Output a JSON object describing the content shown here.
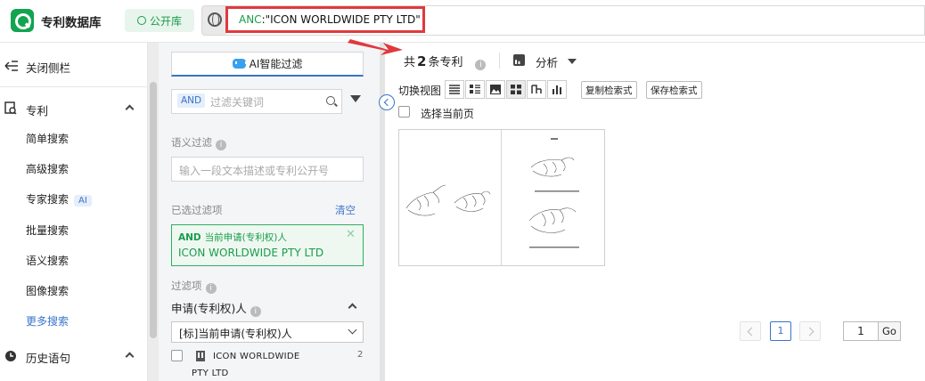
{
  "header": {
    "app_title": "专利数据库",
    "db_button": "公开库",
    "query_field": "ANC",
    "query_value": ":\"ICON WORLDWIDE PTY LTD\""
  },
  "sidebar": {
    "close_label": "关闭侧栏",
    "patent_section": "专利",
    "items": [
      {
        "label": "简单搜索"
      },
      {
        "label": "高级搜索"
      },
      {
        "label": "专家搜索",
        "badge": "AI"
      },
      {
        "label": "批量搜索"
      },
      {
        "label": "语义搜索"
      },
      {
        "label": "图像搜索"
      },
      {
        "label": "更多搜索"
      }
    ],
    "history_section": "历史语句",
    "accent_color": "#3a74c9"
  },
  "filter": {
    "ai_button": "AI智能过滤",
    "logic_tag": "AND",
    "keyword_placeholder": "过滤关键词",
    "semantic_label": "语义过滤",
    "semantic_placeholder": "输入一段文本描述或专利公开号",
    "selected_label": "已选过滤项",
    "clear_label": "清空",
    "chosen": {
      "logic": "AND",
      "field": "当前申请(专利权)人",
      "value": "ICON WORLDWIDE PTY LTD"
    },
    "filters_label": "过滤项",
    "field_title": "申请(专利权)人",
    "field_select_value": "[标]当前申请(专利权)人",
    "option": {
      "line1": "ICON WORLDWIDE",
      "line2": "PTY LTD",
      "count": "2"
    },
    "brand_color": "#1a9b4b"
  },
  "results": {
    "count_prefix": "共",
    "count": "2",
    "count_suffix": "条专利",
    "analysis_label": "分析",
    "view_label": "切换视图",
    "view_icons": [
      "list-icon",
      "detail-list-icon",
      "image-icon",
      "grid-icon",
      "chart-icon",
      "bar-chart-icon"
    ],
    "copy_query": "复制检索式",
    "save_query": "保存检索式",
    "select_page": "选择当前页"
  },
  "pager": {
    "current_page": "1",
    "goto_value": "1",
    "go_label": "Go"
  }
}
